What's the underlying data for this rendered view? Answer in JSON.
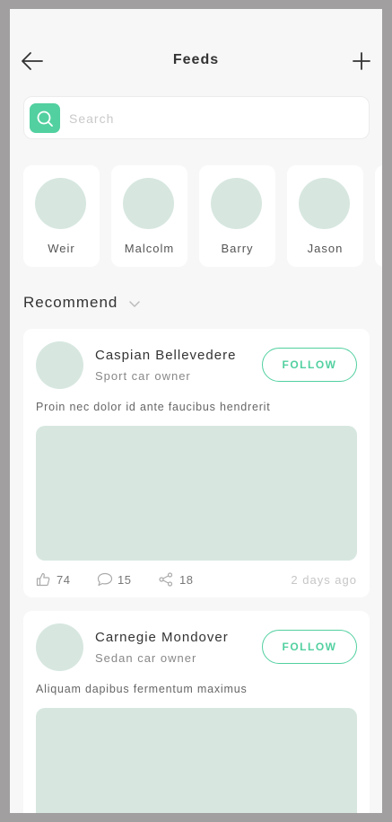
{
  "header": {
    "title": "Feeds",
    "back_icon": "arrow-left-icon",
    "add_icon": "plus-icon"
  },
  "search": {
    "placeholder": "Search",
    "value": "",
    "icon": "search-icon"
  },
  "stories": [
    {
      "name": "Weir"
    },
    {
      "name": "Malcolm"
    },
    {
      "name": "Barry"
    },
    {
      "name": "Jason"
    }
  ],
  "section": {
    "title": "Recommend",
    "chevron_icon": "chevron-down-icon"
  },
  "posts": [
    {
      "author": "Caspian Bellevedere",
      "role": "Sport car owner",
      "follow_label": "FOLLOW",
      "text": "Proin nec dolor id ante faucibus hendrerit",
      "likes": "74",
      "comments": "15",
      "shares": "18",
      "time": "2 days ago"
    },
    {
      "author": "Carnegie Mondover",
      "role": "Sedan car owner",
      "follow_label": "FOLLOW",
      "text": "Aliquam dapibus fermentum maximus"
    }
  ],
  "colors": {
    "accent": "#52d0a0",
    "placeholder_fill": "#d7e7e0",
    "background": "#f7f7f7",
    "frame": "#a19fa0"
  }
}
